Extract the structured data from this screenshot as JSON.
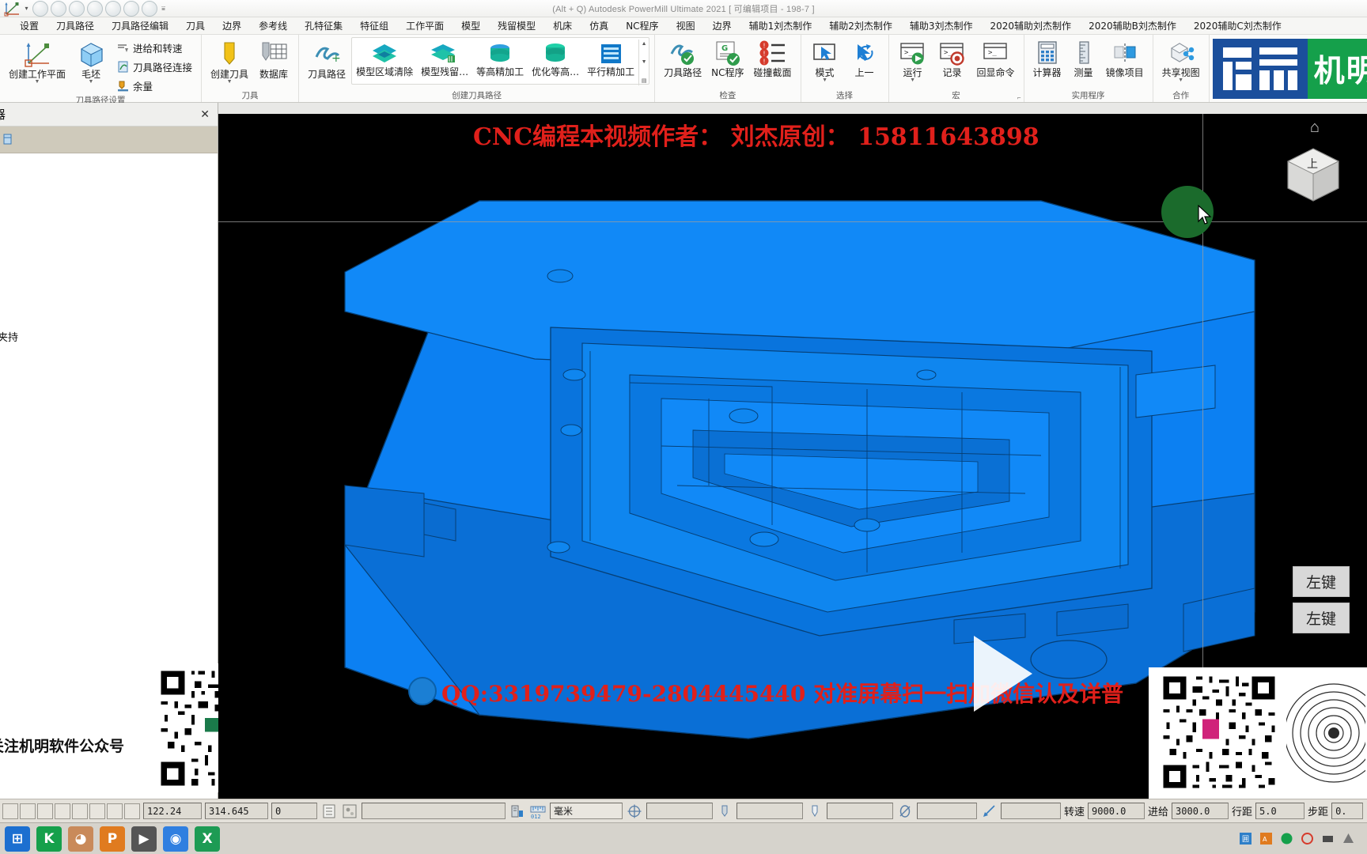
{
  "window": {
    "title": "(Alt + Q) Autodesk PowerMill Ultimate 2021    [ 可编辑项目 - 198-7 ]"
  },
  "quick_access": {
    "icons": [
      "workplane-icon",
      "dropdown-caret-icon",
      "circle-button-1",
      "circle-button-2",
      "circle-button-3",
      "circle-button-4",
      "circle-button-5",
      "circle-button-6",
      "circle-button-7",
      "overflow-menu-icon"
    ]
  },
  "menubar": {
    "items": [
      {
        "label": "设置"
      },
      {
        "label": "刀具路径"
      },
      {
        "label": "刀具路径编辑"
      },
      {
        "label": "刀具"
      },
      {
        "label": "边界"
      },
      {
        "label": "参考线"
      },
      {
        "label": "孔特征集"
      },
      {
        "label": "特征组"
      },
      {
        "label": "工作平面"
      },
      {
        "label": "模型"
      },
      {
        "label": "残留模型"
      },
      {
        "label": "机床"
      },
      {
        "label": "仿真"
      },
      {
        "label": "NC程序"
      },
      {
        "label": "视图"
      },
      {
        "label": "边界"
      },
      {
        "label": "辅助1刘杰制作"
      },
      {
        "label": "辅助2刘杰制作"
      },
      {
        "label": "辅助3刘杰制作"
      },
      {
        "label": "2020辅助刘杰制作"
      },
      {
        "label": "2020辅助B刘杰制作"
      },
      {
        "label": "2020辅助C刘杰制作"
      }
    ]
  },
  "ribbon": {
    "groups": [
      {
        "name": "toolpath-settings",
        "label": "刀具路径设置",
        "large": [
          {
            "label": "创建工作平面",
            "icon": "workplane-axes-icon",
            "caret": true
          },
          {
            "label": "毛坯",
            "icon": "block-cube-icon",
            "caret": true
          }
        ],
        "small": [
          {
            "label": "进给和转速",
            "icon": "feeds-speeds-icon"
          },
          {
            "label": "刀具路径连接",
            "icon": "toolpath-link-icon"
          },
          {
            "label": "余量",
            "icon": "thickness-icon"
          }
        ]
      },
      {
        "name": "tool",
        "label": "刀具",
        "large": [
          {
            "label": "创建刀具",
            "icon": "create-tool-icon",
            "caret": true
          },
          {
            "label": "数据库",
            "icon": "tool-database-icon",
            "caret": false
          }
        ],
        "small": []
      },
      {
        "name": "create-toolpath",
        "label": "创建刀具路径",
        "large": [
          {
            "label": "刀具路径",
            "icon": "toolpath-plus-icon",
            "caret": false
          }
        ],
        "gallery": [
          {
            "label": "模型区域清除",
            "icon": "model-area-clearance-icon"
          },
          {
            "label": "模型残留…",
            "icon": "model-rest-icon"
          },
          {
            "label": "等高精加工",
            "icon": "constant-z-finishing-icon"
          },
          {
            "label": "优化等高…",
            "icon": "optimised-constant-z-icon"
          },
          {
            "label": "平行精加工",
            "icon": "raster-finishing-icon"
          }
        ],
        "gallery_scroll": [
          "scroll-up-icon",
          "scroll-down-icon",
          "gallery-expand-icon"
        ]
      },
      {
        "name": "verify",
        "label": "检查",
        "large": [
          {
            "label": "刀具路径",
            "icon": "verify-toolpath-icon",
            "caret": false
          },
          {
            "label": "NC程序",
            "icon": "verify-ncprogram-icon",
            "caret": false
          },
          {
            "label": "碰撞截面",
            "icon": "collision-section-icon",
            "caret": false
          }
        ],
        "small": []
      },
      {
        "name": "select",
        "label": "选择",
        "large": [
          {
            "label": "模式",
            "icon": "select-mode-icon",
            "caret": true
          },
          {
            "label": "上一",
            "icon": "select-previous-icon",
            "caret": false
          }
        ],
        "small": []
      },
      {
        "name": "macro",
        "label": "宏",
        "large": [
          {
            "label": "运行",
            "icon": "run-macro-icon",
            "caret": true
          },
          {
            "label": "记录",
            "icon": "record-macro-icon",
            "caret": false
          },
          {
            "label": "回显命令",
            "icon": "echo-command-icon",
            "caret": false
          }
        ],
        "launcher": "dialog-launcher-icon"
      },
      {
        "name": "utilities",
        "label": "实用程序",
        "large": [
          {
            "label": "计算器",
            "icon": "calculator-icon",
            "caret": false
          },
          {
            "label": "测量",
            "icon": "measure-ruler-icon",
            "caret": false
          },
          {
            "label": "镜像项目",
            "icon": "mirror-project-icon",
            "caret": false
          }
        ],
        "small": []
      },
      {
        "name": "collaborate",
        "label": "合作",
        "large": [
          {
            "label": "共享视图",
            "icon": "share-view-icon",
            "caret": true
          }
        ],
        "small": []
      }
    ],
    "brand": {
      "mark_icon": "jiming-logo-icon",
      "text": "机明软"
    }
  },
  "explorer": {
    "title": "器",
    "close_icon": "close-icon",
    "selected_row_icon": "explorer-item-icon",
    "floating_text": "印夹持",
    "qr_caption": "关注机明软件公众号",
    "qr_icon": "qr-code-wechat-icon"
  },
  "viewport": {
    "overlay_top": "CNC编程本视频作者： 刘杰原创： 15811643898",
    "overlay_bottom": "QQ:3319739479-2804445440 对准屏幕扫一扫加微信认及详普",
    "qq_badge_icon": "qq-penguin-icon",
    "play_icon": "play-triangle-icon",
    "home_icon": "home-icon",
    "viewcube_label": "上",
    "viewcube_icon": "view-cube-icon",
    "cursor_icon": "mouse-cursor-icon",
    "key_hints": [
      "左键",
      "左键"
    ],
    "qr_icon": "qr-code-wechat-icon",
    "model_color": "#0c80f2",
    "background_color": "#000000"
  },
  "statusbar": {
    "left_buttons": [
      "sb-btn-1",
      "sb-btn-2",
      "sb-btn-3",
      "sb-btn-4",
      "sb-btn-5",
      "sb-btn-6",
      "sb-btn-7",
      "sb-btn-8"
    ],
    "coord_x": "122.24",
    "coord_y": "314.645",
    "level_value": "0",
    "list_icon": "level-list-icon",
    "shade_icon": "shade-toggle-icon",
    "blank_field_1": "",
    "machine_icon": "machine-icon",
    "units_icon": "units-icon",
    "units_value": "毫米",
    "tolerance_icon": "tolerance-icon",
    "tolerance_value": "",
    "diameter_icon": "diameter-icon",
    "diameter_value": "",
    "lead_icon": "lead-angle-icon",
    "lead_value": "",
    "speed_label": "转速",
    "speed_value": "9000.0",
    "feed_label": "进给",
    "feed_value": "3000.0",
    "stepover_label": "行距",
    "stepover_value": "5.0",
    "pitch_label": "步距",
    "pitch_value": "0."
  },
  "taskbar": {
    "apps": [
      {
        "name": "start-button",
        "glyph": "⊞",
        "color": "#1c6fd0"
      },
      {
        "name": "wechat-app-icon",
        "glyph": "K",
        "color": "#15a04b"
      },
      {
        "name": "user-avatar-icon",
        "glyph": "◕",
        "color": "#c98a5a"
      },
      {
        "name": "powermill-app-icon",
        "glyph": "P",
        "color": "#e07b1f"
      },
      {
        "name": "media-app-icon",
        "glyph": "▶",
        "color": "#555555"
      },
      {
        "name": "browser-app-icon",
        "glyph": "◉",
        "color": "#2f7fe0"
      },
      {
        "name": "spreadsheet-app-icon",
        "glyph": "X",
        "color": "#1d9b54"
      }
    ],
    "tray": [
      "tray-icon-1",
      "tray-icon-2",
      "tray-icon-3",
      "tray-icon-4",
      "tray-icon-5",
      "tray-icon-6"
    ],
    "clock": ""
  }
}
